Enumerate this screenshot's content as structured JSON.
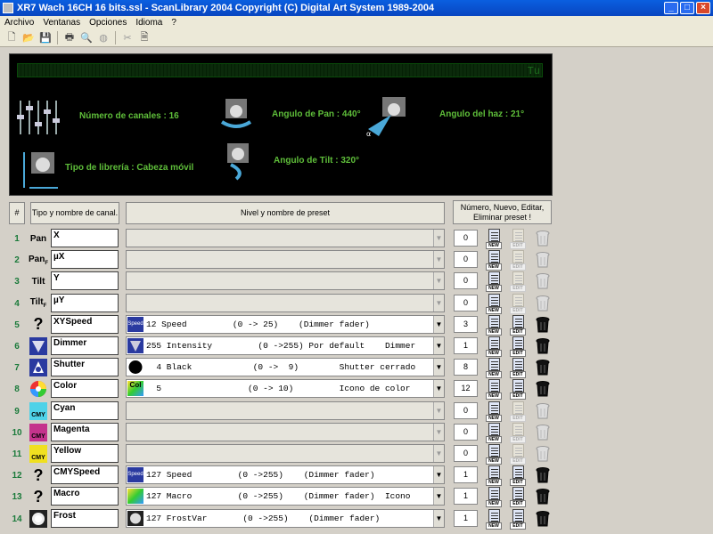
{
  "window": {
    "title": "XR7 Wach 16CH 16 bits.ssl - ScanLibrary 2004   Copyright (C) Digital Art System 1989-2004"
  },
  "menu": [
    "Archivo",
    "Ventanas",
    "Opciones",
    "Idioma",
    "?"
  ],
  "toolbar": {
    "icons": [
      "new-file-icon",
      "open-folder-icon",
      "save-icon",
      "print-icon",
      "print-preview-icon",
      "globe-icon",
      "cut-icon",
      "document-icon"
    ]
  },
  "panel": {
    "lcd_cursor": "Tu",
    "num_channels": "Número de canales : 16",
    "pan_angle": "Angulo de Pan : 440°",
    "beam_angle": "Angulo del haz : 21°",
    "library_type": "Tipo de librería : Cabeza móvil",
    "tilt_angle": "Angulo de Tilt : 320°"
  },
  "headers": {
    "hash": "#",
    "type": "Tipo y nombre de canal.",
    "level": "Nivel y nombre de preset",
    "actions": "Número, Nuevo, Editar, Eliminar preset !"
  },
  "actions": {
    "new": "NEW",
    "edit": "EDIT"
  },
  "rows": [
    {
      "n": "1",
      "type": "Pan",
      "name": "X",
      "preset": "",
      "count": "0",
      "active": false,
      "icon": "pan-text-icon"
    },
    {
      "n": "2",
      "type": "Pan",
      "sub": "F",
      "name": "µX",
      "preset": "",
      "count": "0",
      "active": false,
      "icon": "pan-fine-text-icon"
    },
    {
      "n": "3",
      "type": "Tilt",
      "name": "Y",
      "preset": "",
      "count": "0",
      "active": false,
      "icon": "tilt-text-icon"
    },
    {
      "n": "4",
      "type": "Tilt",
      "sub": "F",
      "name": "µY",
      "preset": "",
      "count": "0",
      "active": false,
      "icon": "tilt-fine-text-icon"
    },
    {
      "n": "5",
      "type": "?",
      "name": "XYSpeed",
      "preset": "12 Speed         (0 -> 25)    (Dimmer fader)",
      "count": "3",
      "active": true,
      "icon": "question-icon",
      "pico": "Speed"
    },
    {
      "n": "6",
      "type": "",
      "name": "Dimmer",
      "preset": "255 Intensity         (0 ->255) Por default    Dimmer",
      "count": "1",
      "active": true,
      "icon": "dimmer-icon",
      "pico": ""
    },
    {
      "n": "7",
      "type": "",
      "name": "Shutter",
      "preset": "  4 Black            (0 ->  9)        Shutter cerrado",
      "count": "8",
      "active": true,
      "icon": "shutter-icon",
      "pico": ""
    },
    {
      "n": "8",
      "type": "",
      "name": "Color",
      "preset": "  5                 (0 -> 10)         Icono de color",
      "count": "12",
      "active": true,
      "icon": "color-wheel-icon",
      "pico": "Col"
    },
    {
      "n": "9",
      "type": "CMY",
      "name": "Cyan",
      "preset": "",
      "count": "0",
      "active": false,
      "icon": "cyan-cmy-icon"
    },
    {
      "n": "10",
      "type": "CMY",
      "name": "Magenta",
      "preset": "",
      "count": "0",
      "active": false,
      "icon": "magenta-cmy-icon"
    },
    {
      "n": "11",
      "type": "CMY",
      "name": "Yellow",
      "preset": "",
      "count": "0",
      "active": false,
      "icon": "yellow-cmy-icon"
    },
    {
      "n": "12",
      "type": "?",
      "name": "CMYSpeed",
      "preset": "127 Speed         (0 ->255)    (Dimmer fader)",
      "count": "1",
      "active": true,
      "icon": "question-icon",
      "pico": "Speed"
    },
    {
      "n": "13",
      "type": "?",
      "name": "Macro",
      "preset": "127 Macro         (0 ->255)    (Dimmer fader)  Icono",
      "count": "1",
      "active": true,
      "icon": "question-icon",
      "pico": ""
    },
    {
      "n": "14",
      "type": "",
      "name": "Frost",
      "preset": "127 FrostVar       (0 ->255)    (Dimmer fader)",
      "count": "1",
      "active": true,
      "icon": "frost-icon",
      "pico": ""
    }
  ],
  "colors": {
    "lcd_text": "#5fbf3a",
    "row_number": "#1a7a3a",
    "cyan": "#4fd2e8",
    "magenta": "#c4338c",
    "yellow": "#f0e020"
  }
}
